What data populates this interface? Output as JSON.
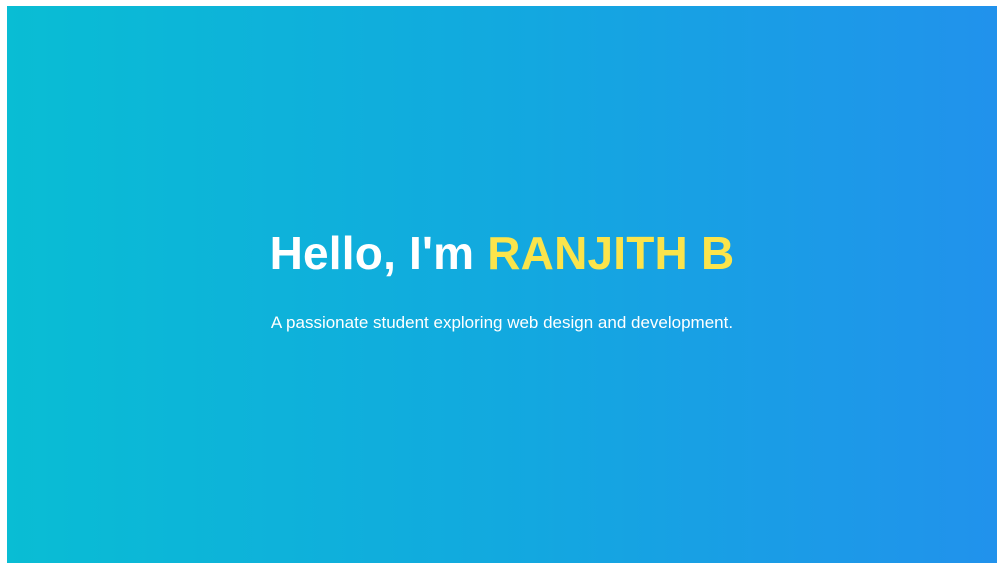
{
  "hero": {
    "greeting": "Hello, I'm ",
    "name": "RANJITH B",
    "subtitle": "A passionate student exploring web design and development."
  },
  "colors": {
    "gradient_start": "#09bdd4",
    "gradient_end": "#2192ec",
    "title_text": "#ffffff",
    "name_highlight": "#fbe44b"
  }
}
